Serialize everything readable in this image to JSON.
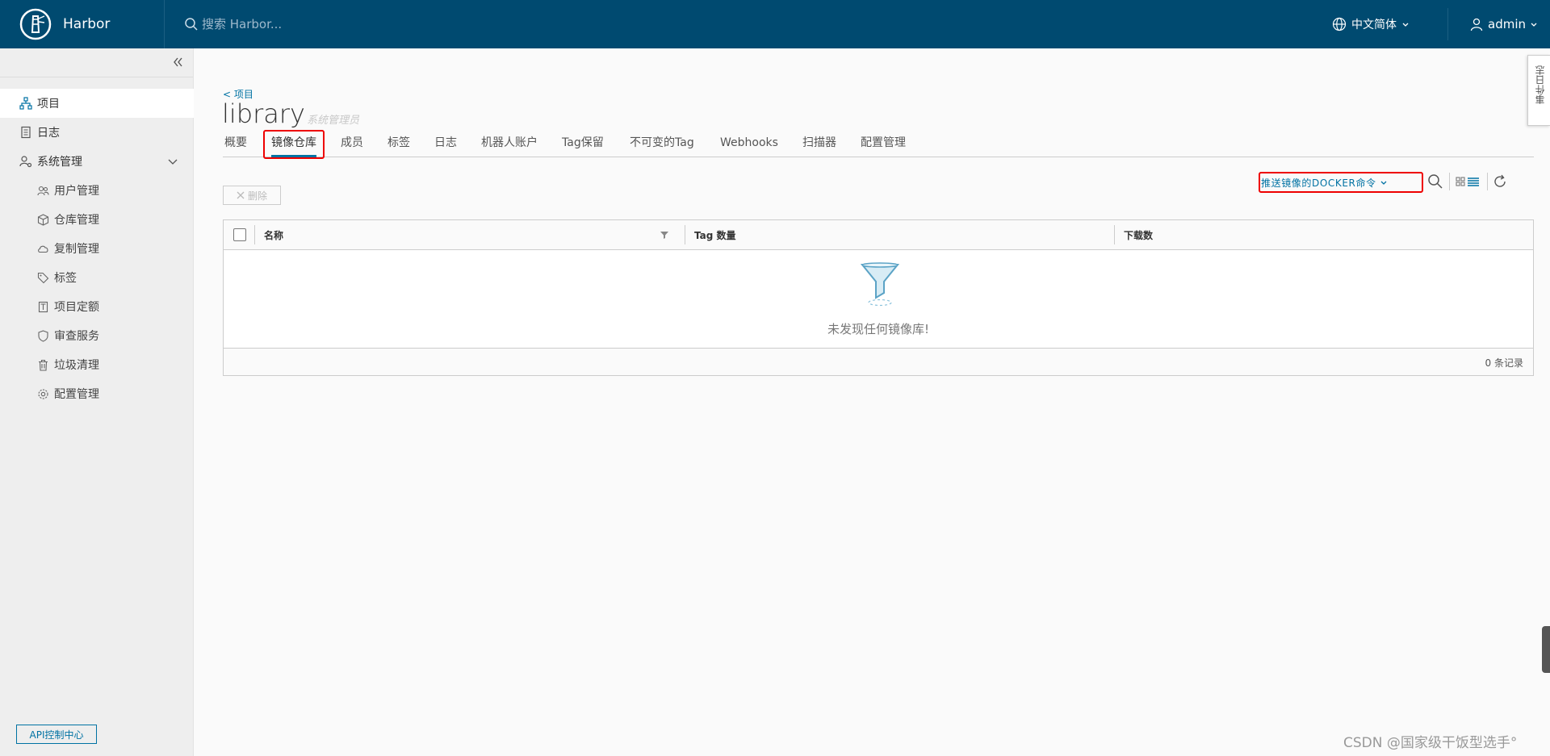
{
  "header": {
    "app_name": "Harbor",
    "search_placeholder": "搜索 Harbor...",
    "language": "中文简体",
    "user": "admin"
  },
  "sidebar": {
    "items": [
      {
        "label": "项目",
        "icon": "projects-icon",
        "active": true
      },
      {
        "label": "日志",
        "icon": "logs-icon"
      },
      {
        "label": "系统管理",
        "icon": "admin-icon",
        "expanded": true
      }
    ],
    "sub_items": [
      {
        "label": "用户管理",
        "icon": "users-icon"
      },
      {
        "label": "仓库管理",
        "icon": "registry-icon"
      },
      {
        "label": "复制管理",
        "icon": "replication-icon"
      },
      {
        "label": "标签",
        "icon": "tag-icon"
      },
      {
        "label": "项目定额",
        "icon": "quota-icon"
      },
      {
        "label": "审查服务",
        "icon": "shield-icon"
      },
      {
        "label": "垃圾清理",
        "icon": "trash-icon"
      },
      {
        "label": "配置管理",
        "icon": "gear-icon"
      }
    ],
    "api_button": "API控制中心"
  },
  "main": {
    "breadcrumb": "< 项目",
    "project_name": "library",
    "role": "系统管理员",
    "tabs": [
      "概要",
      "镜像仓库",
      "成员",
      "标签",
      "日志",
      "机器人账户",
      "Tag保留",
      "不可变的Tag",
      "Webhooks",
      "扫描器",
      "配置管理"
    ],
    "active_tab": "镜像仓库",
    "delete_button": "删除",
    "push_command": "推送镜像的DOCKER命令",
    "table": {
      "columns": [
        "名称",
        "Tag 数量",
        "下载数"
      ],
      "empty_text": "未发现任何镜像库!",
      "footer": "0 条记录"
    }
  },
  "side_tab": "事件日志",
  "watermark": "CSDN @国家级干饭型选手°",
  "colors": {
    "header_bg": "#004a70",
    "accent": "#0072a3",
    "highlight": "#ee0000"
  }
}
